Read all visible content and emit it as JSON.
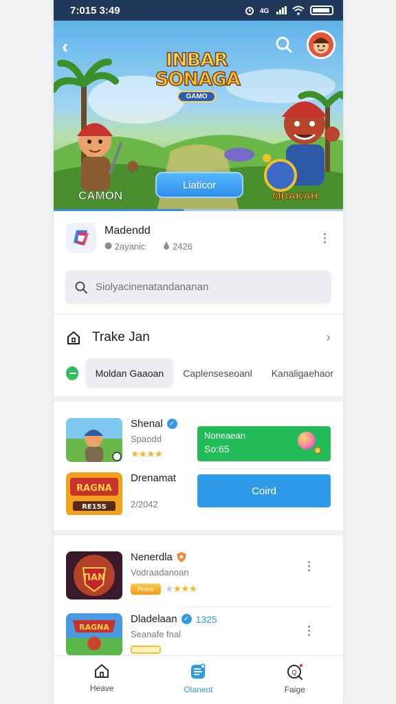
{
  "status_bar": {
    "time": "7:015 3:49",
    "icons": [
      "alarm-icon",
      "signal-icon",
      "wifi-icon",
      "battery-icon"
    ]
  },
  "hero": {
    "logo_line1": "INBAR",
    "logo_line2": "SONAGA",
    "logo_badge": "GAMO",
    "button_label": "Liaticor",
    "tag_left": "CAMON",
    "tag_right": "MBAKAH",
    "progress": 0.45
  },
  "app": {
    "name": "Madendd",
    "developer": "2ayanic",
    "count": "2426"
  },
  "search": {
    "placeholder": "Siolyacinenatandananan"
  },
  "track": {
    "title": "Trake Jan"
  },
  "chips": [
    "Moldan Gaaoan",
    "Caplenseseoanl",
    "Kanaligaehaor"
  ],
  "cards": [
    {
      "title": "Shenal",
      "subtitle": "Spaodd",
      "stars": "★★★★"
    },
    {
      "title": "Drenamat",
      "subtitle": "2/2042",
      "thumb_text": "RAGNA",
      "thumb_sub": "RE15S"
    }
  ],
  "promo": {
    "line1": "Noneaean",
    "line2": "So:65",
    "button_label": "Coird"
  },
  "list": [
    {
      "title": "Nenerdla",
      "subtitle": "Vodraadanoan",
      "badge": "Prono",
      "stars_filled": "★",
      "stars_empty": "★★★"
    },
    {
      "title": "Dladelaan",
      "count": "1325",
      "subtitle": "Seanafe fnal"
    }
  ],
  "nav": [
    {
      "label": "Heave",
      "icon": "home-icon"
    },
    {
      "label": "Olaneot",
      "icon": "inbox-icon"
    },
    {
      "label": "Faige",
      "icon": "search-bell-icon"
    }
  ],
  "colors": {
    "status_bar": "#20385a",
    "accent_blue": "#2f9be8",
    "accent_green": "#21bb57"
  }
}
